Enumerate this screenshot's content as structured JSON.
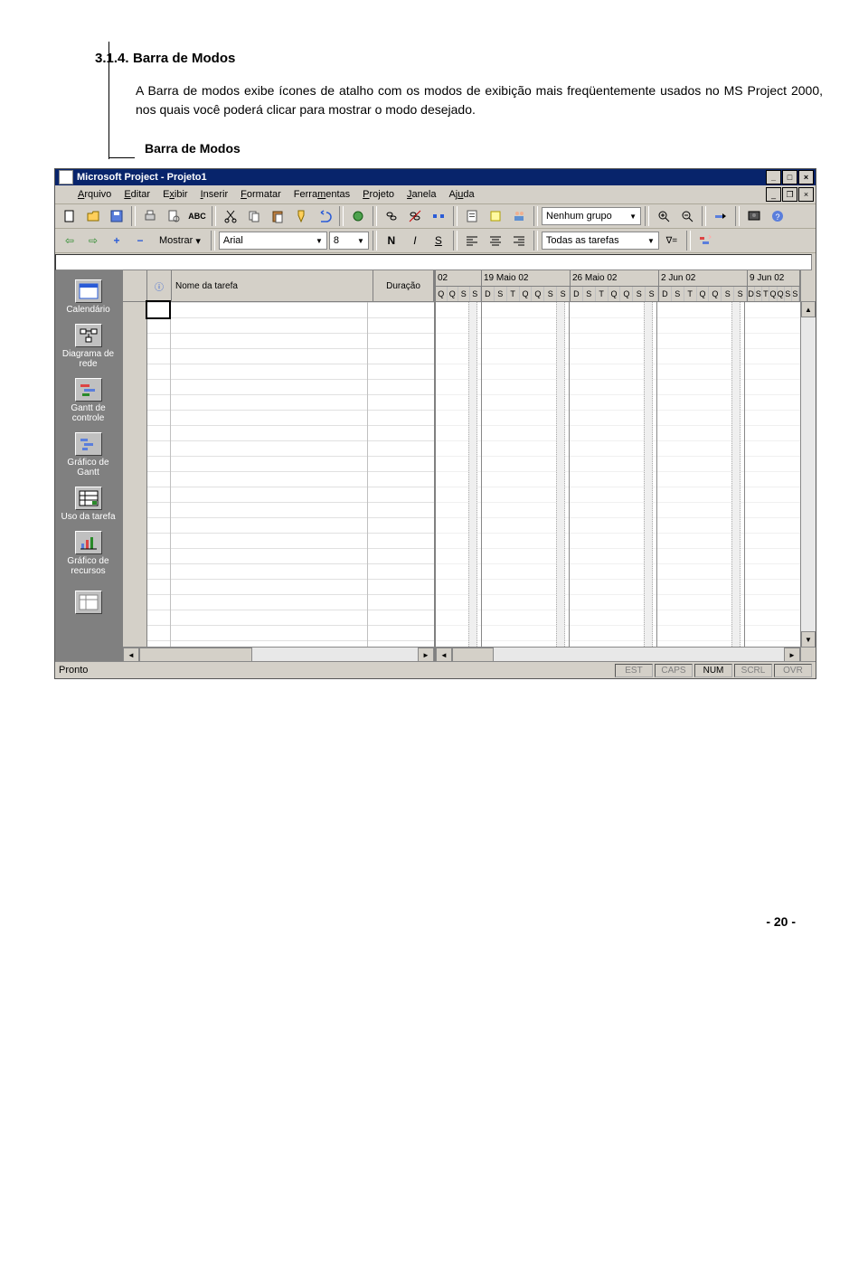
{
  "section": {
    "number": "3.1.4.",
    "title": "Barra de Modos"
  },
  "paragraph": "A Barra de modos exibe ícones de atalho com os modos de exibição mais freqüentemente usados no MS Project 2000, nos quais você poderá clicar para mostrar o modo desejado.",
  "callout": "Barra de Modos",
  "screenshot": {
    "title": "Microsoft Project - Projeto1",
    "menus": [
      "Arquivo",
      "Editar",
      "Exibir",
      "Inserir",
      "Formatar",
      "Ferramentas",
      "Projeto",
      "Janela",
      "Ajuda"
    ],
    "toolbar1": {
      "group_combo": "Nenhum grupo"
    },
    "toolbar2": {
      "show_label": "Mostrar",
      "font": "Arial",
      "size": "8",
      "filter": "Todas as tarefas"
    },
    "modes": [
      "Calendário",
      "Diagrama de rede",
      "Gantt de controle",
      "Gráfico de Gantt",
      "Uso da tarefa",
      "Gráfico de recursos"
    ],
    "task_headers": {
      "info": "ⓘ",
      "name": "Nome da tarefa",
      "duration": "Duração"
    },
    "timescale": {
      "weeks": [
        "02",
        "19 Maio 02",
        "26 Maio 02",
        "2 Jun 02",
        "9 Jun 02"
      ],
      "days_first": [
        "Q",
        "Q",
        "S",
        "S"
      ],
      "days": [
        "D",
        "S",
        "T",
        "Q",
        "Q",
        "S",
        "S"
      ]
    },
    "status": {
      "ready": "Pronto",
      "indicators": [
        "EST",
        "CAPS",
        "NUM",
        "SCRL",
        "OVR"
      ],
      "active": "NUM"
    }
  },
  "page_number": "- 20 -"
}
